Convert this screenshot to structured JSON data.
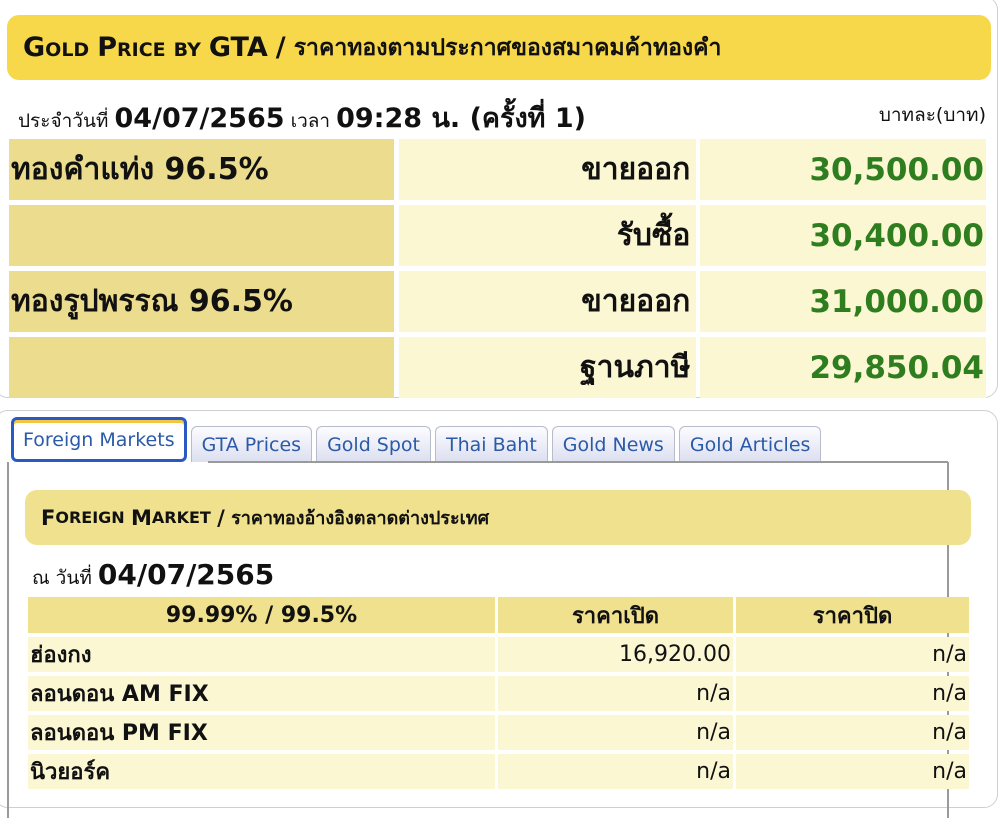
{
  "header": {
    "title_en_words": [
      {
        "big": "G",
        "small": "OLD"
      },
      {
        "big": "P",
        "small": "RICE"
      },
      {
        "big": "",
        "small": "BY"
      },
      {
        "big": "GTA",
        "small": ""
      }
    ],
    "title_sep": "/",
    "title_th": "ราคาทองตามประกาศของสมาคมค้าทองคำ",
    "date_prefix": "ประจำวันที่",
    "date": "04/07/2565",
    "time_prefix": "เวลา",
    "time": "09:28 น. (ครั้งที่ 1)",
    "unit": "บาทละ(บาท)"
  },
  "gold_prices": {
    "rows": [
      {
        "name": "ทองคำแท่ง 96.5%",
        "type": "ขายออก",
        "value": "30,500.00"
      },
      {
        "name": "",
        "type": "รับซื้อ",
        "value": "30,400.00"
      },
      {
        "name": "ทองรูปพรรณ 96.5%",
        "type": "ขายออก",
        "value": "31,000.00"
      },
      {
        "name": "",
        "type": "ฐานภาษี",
        "value": "29,850.04"
      }
    ],
    "value_color": "#2e7d1f"
  },
  "tabs": [
    {
      "label": "Foreign Markets",
      "active": true
    },
    {
      "label": "GTA Prices",
      "active": false
    },
    {
      "label": "Gold Spot",
      "active": false
    },
    {
      "label": "Thai Baht",
      "active": false
    },
    {
      "label": "Gold News",
      "active": false
    },
    {
      "label": "Gold Articles",
      "active": false
    }
  ],
  "foreign_market": {
    "title_en": "FOREIGN MARKET",
    "title_big_1": "F",
    "title_small_1": "OREIGN",
    "title_big_2": "M",
    "title_small_2": "ARKET",
    "title_sep": "/",
    "title_th": "ราคาทองอ้างอิงตลาดต่างประเทศ",
    "date_prefix": "ณ วันที่",
    "date": "04/07/2565",
    "columns": [
      "99.99% / 99.5%",
      "ราคาเปิด",
      "ราคาปิด"
    ],
    "rows": [
      {
        "market": "ฮ่องกง",
        "open": "16,920.00",
        "close": "n/a"
      },
      {
        "market": "ลอนดอน AM FIX",
        "open": "n/a",
        "close": "n/a"
      },
      {
        "market": "ลอนดอน PM FIX",
        "open": "n/a",
        "close": "n/a"
      },
      {
        "market": "นิวยอร์ค",
        "open": "n/a",
        "close": "n/a"
      }
    ]
  },
  "colors": {
    "title_bar": "#f7d84a",
    "label_cell": "#ecdc8e",
    "value_cell": "#fbf7d3",
    "tab_active_border": "#2b59c3",
    "tab_text": "#2a5aa8"
  }
}
